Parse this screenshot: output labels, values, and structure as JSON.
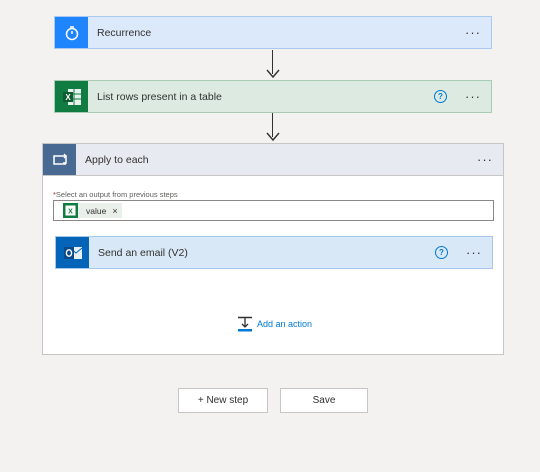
{
  "steps": {
    "recurrence": {
      "title": "Recurrence",
      "more": "···"
    },
    "list_rows": {
      "title": "List rows present in a table",
      "help": "?",
      "more": "···"
    },
    "apply_each": {
      "title": "Apply to each",
      "more": "···",
      "required_mark": "*",
      "field_label": "Select an output from previous steps",
      "token_label": "value",
      "token_remove": "×",
      "inner_action": {
        "title": "Send an email (V2)",
        "help": "?",
        "more": "···"
      },
      "add_action": "Add an action"
    }
  },
  "footer": {
    "new_step": "+ New step",
    "save": "Save"
  },
  "colors": {
    "recurrence_bg": "#dce9fb",
    "recurrence_icon": "#1f85ff",
    "excel_bg": "#dceae1",
    "excel_icon": "#107c41",
    "apply_bg": "#e7eaf0",
    "apply_icon": "#486991",
    "outlook_bg": "#d9e8f6",
    "outlook_icon": "#0364b8"
  }
}
